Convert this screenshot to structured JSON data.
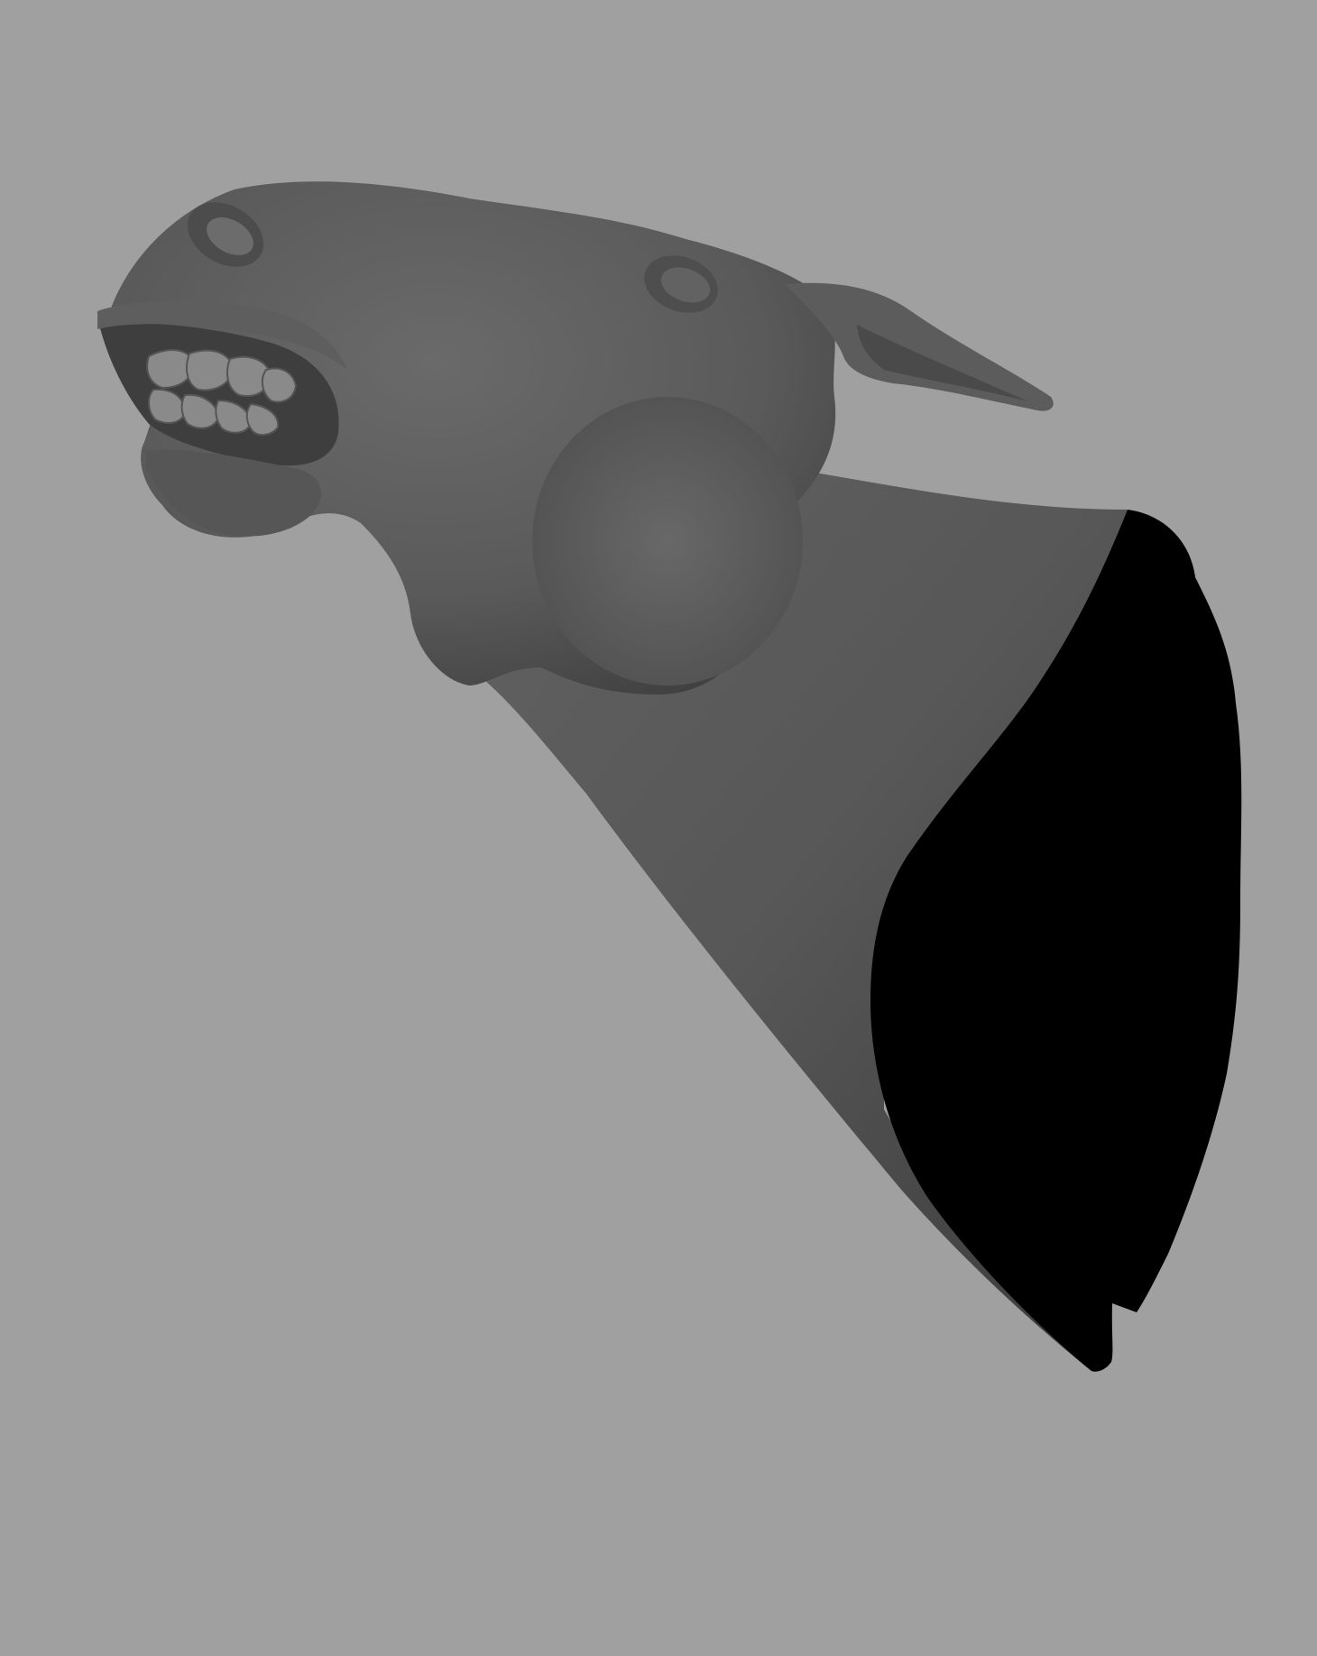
{
  "viewport": {
    "background_color": "#a0a0a0",
    "subject": "horse-head-sculpt",
    "model_color": "#5a5a5a",
    "shadow_color": "#000000",
    "teeth_color": "#8a8a8a"
  }
}
